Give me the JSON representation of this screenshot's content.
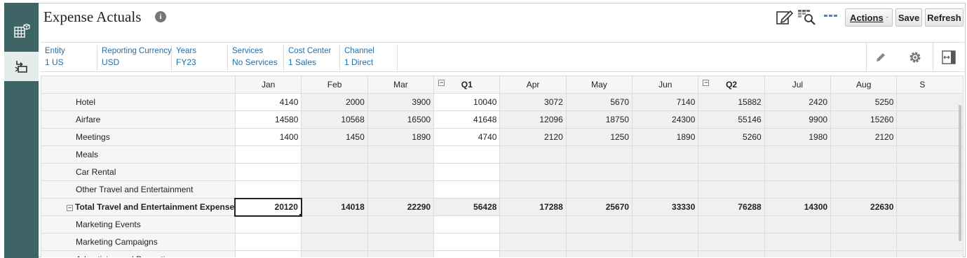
{
  "header": {
    "title": "Expense Actuals",
    "info_glyph": "i",
    "actions_label": "Actions",
    "save_label": "Save",
    "refresh_label": "Refresh"
  },
  "pov": [
    {
      "label": "Entity",
      "value": "1 US"
    },
    {
      "label": "Reporting Currency",
      "value": "USD"
    },
    {
      "label": "Years",
      "value": "FY23"
    },
    {
      "label": "Services",
      "value": "No Services"
    },
    {
      "label": "Cost Center",
      "value": "1 Sales"
    },
    {
      "label": "Channel",
      "value": "1 Direct"
    }
  ],
  "grid": {
    "columns": [
      "Jan",
      "Feb",
      "Mar",
      "Q1",
      "Apr",
      "May",
      "Jun",
      "Q2",
      "Jul",
      "Aug",
      "S"
    ],
    "rows": [
      {
        "label": "Hotel",
        "values": [
          "4140",
          "2000",
          "3900",
          "10040",
          "3072",
          "5670",
          "7140",
          "15882",
          "2420",
          "5250",
          ""
        ]
      },
      {
        "label": "Airfare",
        "values": [
          "14580",
          "10568",
          "16500",
          "41648",
          "12096",
          "18750",
          "24300",
          "55146",
          "9900",
          "15260",
          ""
        ]
      },
      {
        "label": "Meetings",
        "values": [
          "1400",
          "1450",
          "1890",
          "4740",
          "2120",
          "1250",
          "1890",
          "5260",
          "1980",
          "2120",
          ""
        ]
      },
      {
        "label": "Meals",
        "values": [
          "",
          "",
          "",
          "",
          "",
          "",
          "",
          "",
          "",
          "",
          ""
        ]
      },
      {
        "label": "Car Rental",
        "values": [
          "",
          "",
          "",
          "",
          "",
          "",
          "",
          "",
          "",
          "",
          ""
        ]
      },
      {
        "label": "Other Travel and Entertainment",
        "values": [
          "",
          "",
          "",
          "",
          "",
          "",
          "",
          "",
          "",
          "",
          ""
        ]
      },
      {
        "label": "Total Travel and Entertainment Expense",
        "values": [
          "20120",
          "14018",
          "22290",
          "56428",
          "17288",
          "25670",
          "33330",
          "76288",
          "14300",
          "22630",
          ""
        ]
      },
      {
        "label": "Marketing Events",
        "values": [
          "",
          "",
          "",
          "",
          "",
          "",
          "",
          "",
          "",
          "",
          ""
        ]
      },
      {
        "label": "Marketing Campaigns",
        "values": [
          "",
          "",
          "",
          "",
          "",
          "",
          "",
          "",
          "",
          "",
          ""
        ]
      },
      {
        "label": "Advertising and Promotion",
        "values": [
          "",
          "",
          "",
          "",
          "",
          "",
          "",
          "",
          "",
          "",
          ""
        ]
      }
    ]
  },
  "colors": {
    "rail": "#3f6465",
    "rail_active": "#e4ecec",
    "link": "#1f6fa8",
    "grid_border": "#dcdcdc",
    "readonly_cell": "#eef0f2"
  },
  "icons": [
    "grid-cube-icon",
    "navigator-icon",
    "info-icon",
    "edit-form-icon",
    "query-icon",
    "more-icon",
    "pencil-icon",
    "gear-icon",
    "expand-icon",
    "caret-down-icon",
    "collapse-minus-icon"
  ]
}
